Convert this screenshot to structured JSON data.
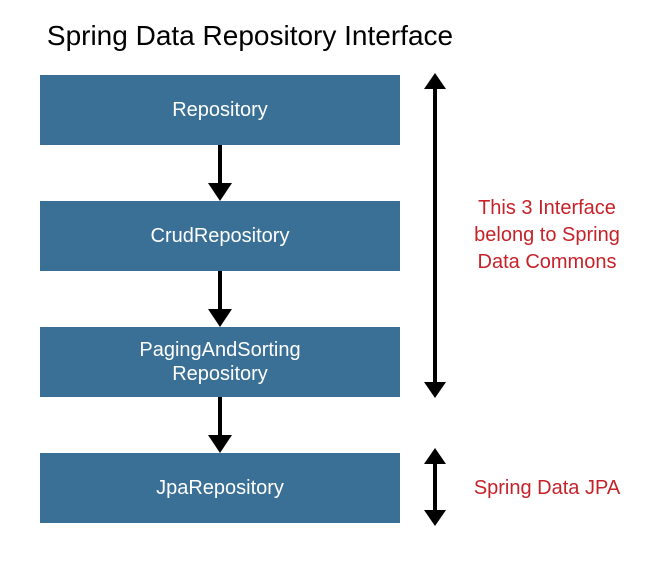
{
  "title": "Spring Data Repository Interface",
  "boxes": [
    {
      "line1": "Repository",
      "line2": ""
    },
    {
      "line1": "CrudRepository",
      "line2": ""
    },
    {
      "line1": "PagingAndSorting",
      "line2": "Repository"
    },
    {
      "line1": "JpaRepository",
      "line2": ""
    }
  ],
  "annotations": {
    "commons_line1": "This 3 Interface",
    "commons_line2": "belong to Spring",
    "commons_line3": "Data Commons",
    "jpa": "Spring Data JPA"
  },
  "colors": {
    "box_bg": "#3a6f96",
    "annotation_text": "#c52229"
  }
}
